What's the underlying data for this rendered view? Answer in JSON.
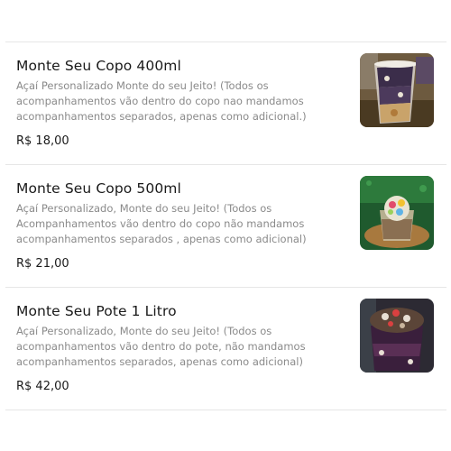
{
  "menu": {
    "items": [
      {
        "title": "Monte Seu Copo 400ml",
        "description": "Açaí Personalizado Monte do seu Jeito! (Todos os acompanhamentos vão dentro do copo nao mandamos acompanhamentos separados, apenas como adicional.)",
        "price": "R$ 18,00",
        "photo": "acai-cup-400ml-photo"
      },
      {
        "title": "Monte Seu Copo 500ml",
        "description": "Açaí Personalizado, Monte do seu Jeito! (Todos os Acompanhamentos vão dentro do copo não mandamos acompanhamentos separados , apenas como adicional)",
        "price": "R$ 21,00",
        "photo": "acai-cup-500ml-photo"
      },
      {
        "title": "Monte Seu Pote 1 Litro",
        "description": "Açaí Personalizado, Monte do seu Jeito! (Todos os acompanhamentos vão dentro do pote, não mandamos acompanhamentos separados, apenas como adicional)",
        "price": "R$ 42,00",
        "photo": "acai-pot-1l-photo"
      }
    ]
  }
}
